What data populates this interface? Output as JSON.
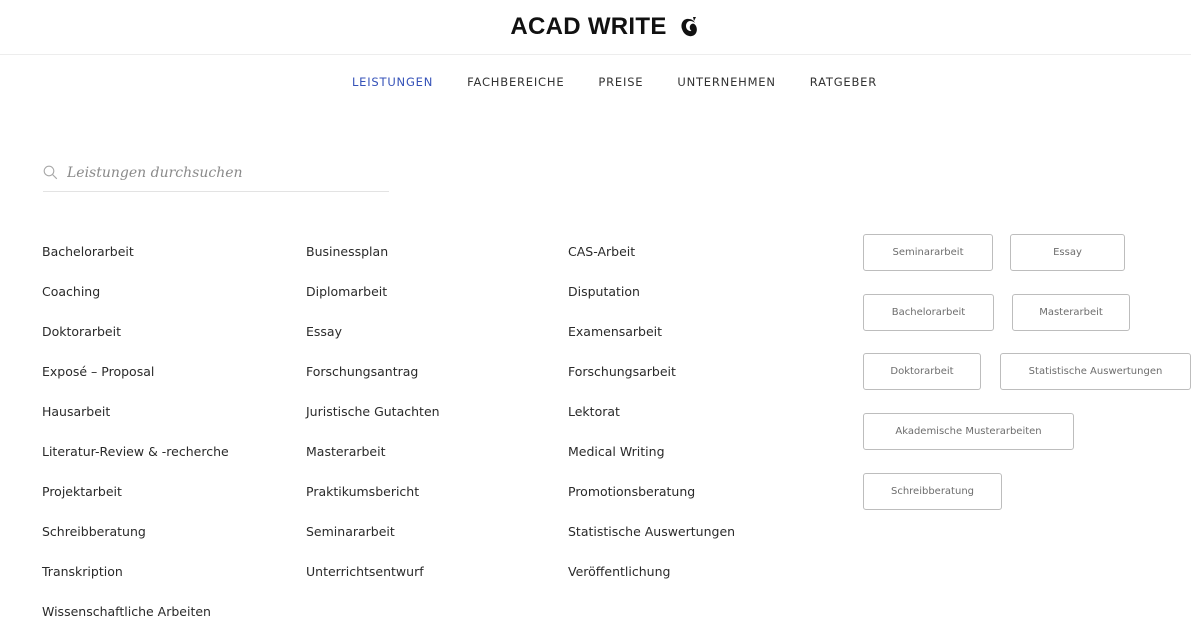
{
  "header": {
    "logo_text": "ACAD WRITE"
  },
  "nav": {
    "items": [
      {
        "label": "LEISTUNGEN"
      },
      {
        "label": "FACHBEREICHE"
      },
      {
        "label": "PREISE"
      },
      {
        "label": "UNTERNEHMEN"
      },
      {
        "label": "RATGEBER"
      }
    ],
    "active": "LEISTUNGEN",
    "active_color": "#3552b8"
  },
  "search": {
    "placeholder": "Leistungen durchsuchen",
    "value": "",
    "icon": "search-icon"
  },
  "services": {
    "column1": [
      "Bachelorarbeit",
      "Coaching",
      "Doktorarbeit",
      "Exposé – Proposal",
      "Hausarbeit",
      "Literatur-Review & -recherche",
      "Projektarbeit",
      "Schreibberatung",
      "Transkription",
      "Wissenschaftliche Arbeiten"
    ],
    "column2": [
      "Businessplan",
      "Diplomarbeit",
      "Essay",
      "Forschungsantrag",
      "Juristische Gutachten",
      "Masterarbeit",
      "Praktikumsbericht",
      "Seminararbeit",
      "Unterrichtsentwurf"
    ],
    "column3": [
      "CAS-Arbeit",
      "Disputation",
      "Examensarbeit",
      "Forschungsarbeit",
      "Lektorat",
      "Medical Writing",
      "Promotionsberatung",
      "Statistische Auswertungen",
      "Veröffentlichung"
    ]
  },
  "popular_tags": [
    "Seminararbeit",
    "Essay",
    "Bachelorarbeit",
    "Masterarbeit",
    "Doktorarbeit",
    "Statistische Auswertungen",
    "Akademische Musterarbeiten",
    "Schreibberatung"
  ]
}
